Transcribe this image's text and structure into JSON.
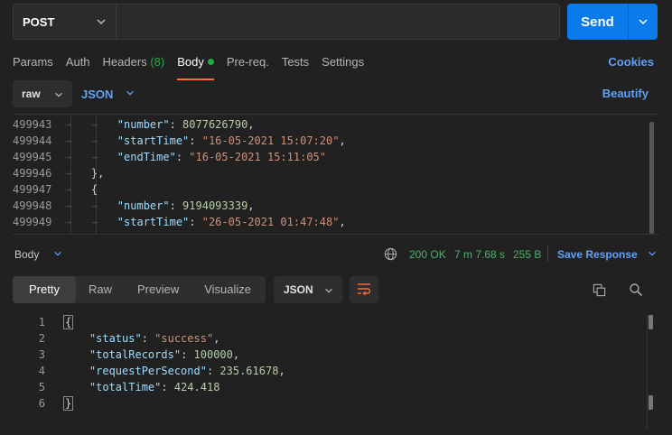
{
  "request": {
    "method": "POST",
    "url": "",
    "send_label": "Send"
  },
  "tabs": [
    {
      "label": "Params"
    },
    {
      "label": "Auth"
    },
    {
      "label": "Headers",
      "count": "(8)"
    },
    {
      "label": "Body",
      "active": true
    },
    {
      "label": "Pre-req."
    },
    {
      "label": "Tests"
    },
    {
      "label": "Settings"
    }
  ],
  "cookies_label": "Cookies",
  "body_mode": "raw",
  "body_lang": "JSON",
  "beautify_label": "Beautify",
  "editor_lines": [
    {
      "ln": "499943",
      "key": "\"number\"",
      "val": "8077626790",
      "type": "num",
      "suffix": ","
    },
    {
      "ln": "499944",
      "key": "\"startTime\"",
      "val": "\"16-05-2021 15:07:20\"",
      "type": "str",
      "suffix": ","
    },
    {
      "ln": "499945",
      "key": "\"endTime\"",
      "val": "\"16-05-2021 15:11:05\"",
      "type": "str",
      "suffix": ""
    },
    {
      "ln": "499946",
      "text": "},"
    },
    {
      "ln": "499947",
      "text": "{"
    },
    {
      "ln": "499948",
      "key": "\"number\"",
      "val": "9194093339",
      "type": "num",
      "suffix": ","
    },
    {
      "ln": "499949",
      "key": "\"startTime\"",
      "val": "\"26-05-2021 01:47:48\"",
      "type": "str",
      "suffix": ","
    }
  ],
  "response": {
    "body_label": "Body",
    "status": "200 OK",
    "time": "7 m 7.68 s",
    "size": "255 B",
    "save_label": "Save Response",
    "view_tabs": [
      {
        "label": "Pretty",
        "active": true
      },
      {
        "label": "Raw"
      },
      {
        "label": "Preview"
      },
      {
        "label": "Visualize"
      }
    ],
    "format": "JSON",
    "lines": [
      {
        "ln": "1",
        "text": "{"
      },
      {
        "ln": "2",
        "key": "\"status\"",
        "val": "\"success\"",
        "type": "str",
        "suffix": ","
      },
      {
        "ln": "3",
        "key": "\"totalRecords\"",
        "val": "100000",
        "type": "num",
        "suffix": ","
      },
      {
        "ln": "4",
        "key": "\"requestPerSecond\"",
        "val": "235.61678",
        "type": "num",
        "suffix": ","
      },
      {
        "ln": "5",
        "key": "\"totalTime\"",
        "val": "424.418",
        "type": "num",
        "suffix": ""
      },
      {
        "ln": "6",
        "text": "}"
      }
    ]
  },
  "colors": {
    "accent": "#097bed",
    "tab_underline": "#ff6c37",
    "status_green": "#49b36a",
    "link_blue": "#5ea1f5"
  },
  "icons": [
    "chevron-down-icon",
    "globe-icon",
    "wrap-lines-icon",
    "copy-icon",
    "search-icon"
  ]
}
